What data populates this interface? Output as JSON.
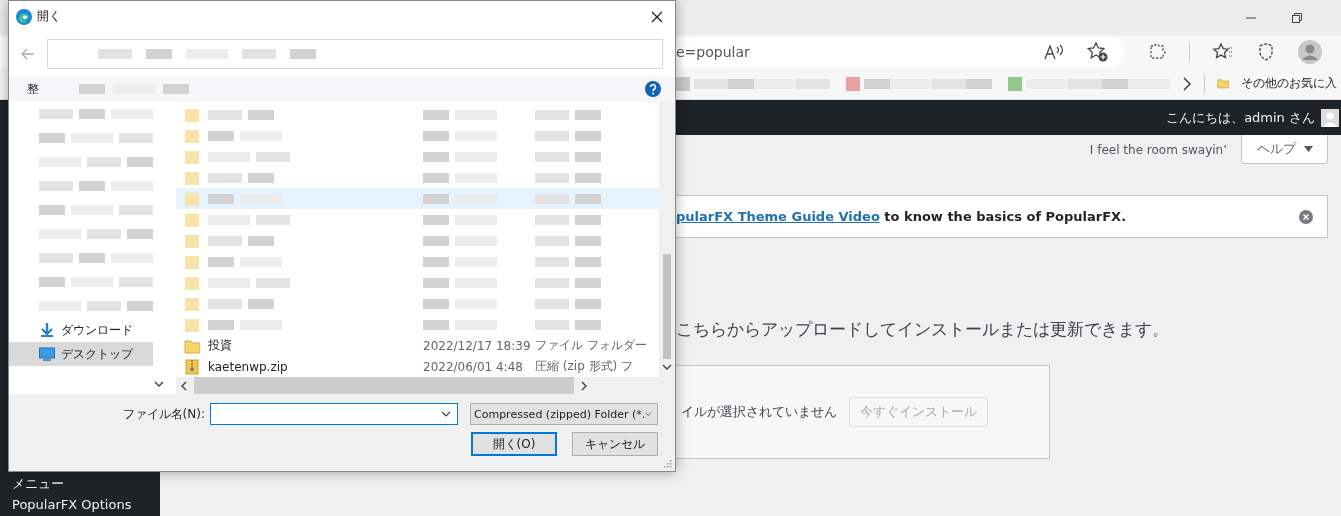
{
  "browser": {
    "address": "e=popular",
    "bookmarks": [
      {
        "kind": "redacted",
        "color": "#c8c8c8"
      },
      {
        "kind": "redacted",
        "color": "#e8a0a0"
      },
      {
        "kind": "redacted",
        "color": "#90c890"
      }
    ],
    "other_favorites": "その他のお気に入"
  },
  "dialog": {
    "title": "開く",
    "toolbar_label": "整",
    "nav": [
      {
        "kind": "redacted",
        "selected": false
      },
      {
        "kind": "redacted",
        "selected": false
      },
      {
        "kind": "redacted",
        "selected": false
      },
      {
        "kind": "redacted",
        "selected": false
      },
      {
        "kind": "redacted",
        "selected": false
      },
      {
        "kind": "redacted",
        "selected": false
      },
      {
        "kind": "redacted",
        "selected": false
      },
      {
        "kind": "redacted",
        "selected": false
      },
      {
        "kind": "redacted",
        "selected": false
      },
      {
        "kind": "download",
        "label": "ダウンロード",
        "selected": false
      },
      {
        "kind": "desktop",
        "label": "デスクトップ",
        "selected": true
      }
    ],
    "files": [
      {
        "kind": "redacted",
        "selected": false
      },
      {
        "kind": "redacted",
        "selected": false
      },
      {
        "kind": "redacted",
        "selected": false
      },
      {
        "kind": "redacted",
        "selected": false
      },
      {
        "kind": "redacted",
        "selected": true
      },
      {
        "kind": "redacted",
        "selected": false
      },
      {
        "kind": "redacted",
        "selected": false
      },
      {
        "kind": "redacted",
        "selected": false
      },
      {
        "kind": "redacted",
        "selected": false
      },
      {
        "kind": "redacted",
        "selected": false
      },
      {
        "kind": "redacted",
        "selected": false
      },
      {
        "kind": "folder",
        "name": "投資",
        "date": "2022/12/17 18:39",
        "type": "ファイル フォルダー",
        "selected": false
      },
      {
        "kind": "zip",
        "name": "kaetenwp.zip",
        "date": "2022/06/01 4:48",
        "type": "圧縮 (zip 形式) フ",
        "selected": false
      }
    ],
    "filename_label": "ファイル名(N):",
    "file_type": "Compressed (zipped) Folder (*.",
    "buttons": [
      {
        "label": "開く(O)",
        "default": true
      },
      {
        "label": "キャンセル",
        "default": false
      }
    ]
  },
  "admin_bar": {
    "greeting": "こんにちは、admin さん"
  },
  "header": {
    "tagline": "I feel the room swayin’",
    "help": "ヘルプ"
  },
  "notice": {
    "link": "pularFX Theme Guide Video",
    "text": " to know the basics of PopularFX."
  },
  "upload": {
    "heading": "こちらからアップロードしてインストールまたは更新できます。",
    "status": "イルが選択されていません",
    "install_button": {
      "label": "今すぐインストール",
      "disabled": true
    }
  },
  "sidebar": {
    "items": [
      "メニュー",
      "PopularFX Options"
    ]
  }
}
